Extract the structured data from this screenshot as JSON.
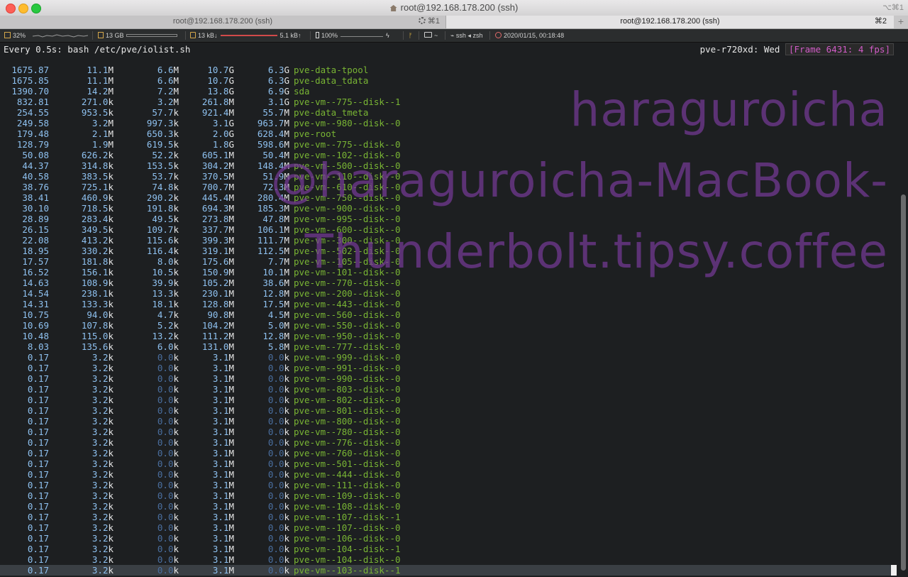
{
  "window": {
    "title": "root@192.168.178.200 (ssh)",
    "shortcut": "⌥⌘1"
  },
  "tabs": [
    {
      "label": "root@192.168.178.200 (ssh)",
      "shortcut": "⌘1",
      "active": false
    },
    {
      "label": "root@192.168.178.200 (ssh)",
      "shortcut": "⌘2",
      "active": true
    }
  ],
  "status_bar": {
    "cpu": "32%",
    "mem": "13 GB",
    "net_down": "13 kB↓",
    "net_up": "5.1 kB↑",
    "battery": "100%",
    "path": "~",
    "shell": "ssh ◂ zsh",
    "datetime": "2020/01/15, 00:18:48"
  },
  "terminal": {
    "command": "Every 0.5s: bash /etc/pve/iolist.sh",
    "host_prefix": "pve-r720xd: Wed ",
    "frame": "[Frame 6431: 4 fps]",
    "rows": [
      [
        "1675.87",
        "11.1M",
        "6.6M",
        "10.7G",
        "6.3G",
        "pve-data-tpool"
      ],
      [
        "1675.85",
        "11.1M",
        "6.6M",
        "10.7G",
        "6.3G",
        "pve-data_tdata"
      ],
      [
        "1390.70",
        "14.2M",
        "7.2M",
        "13.8G",
        "6.9G",
        "sda"
      ],
      [
        "832.81",
        "271.0k",
        "3.2M",
        "261.8M",
        "3.1G",
        "pve-vm--775--disk--1"
      ],
      [
        "254.55",
        "953.5k",
        "57.7k",
        "921.4M",
        "55.7M",
        "pve-data_tmeta"
      ],
      [
        "249.58",
        "3.2M",
        "997.3k",
        "3.1G",
        "963.7M",
        "pve-vm--980--disk--0"
      ],
      [
        "179.48",
        "2.1M",
        "650.3k",
        "2.0G",
        "628.4M",
        "pve-root"
      ],
      [
        "128.79",
        "1.9M",
        "619.5k",
        "1.8G",
        "598.6M",
        "pve-vm--775--disk--0"
      ],
      [
        "50.08",
        "626.2k",
        "52.2k",
        "605.1M",
        "50.4M",
        "pve-vm--102--disk--0"
      ],
      [
        "44.37",
        "314.8k",
        "153.5k",
        "304.2M",
        "148.4M",
        "pve-vm--500--disk--0"
      ],
      [
        "40.58",
        "383.5k",
        "53.7k",
        "370.5M",
        "51.9M",
        "pve-vm--110--disk--0"
      ],
      [
        "38.76",
        "725.1k",
        "74.8k",
        "700.7M",
        "72.3M",
        "pve-vm--610--disk--0"
      ],
      [
        "38.41",
        "460.9k",
        "290.2k",
        "445.4M",
        "280.4M",
        "pve-vm--750--disk--0"
      ],
      [
        "30.10",
        "718.5k",
        "191.8k",
        "694.3M",
        "185.3M",
        "pve-vm--900--disk--0"
      ],
      [
        "28.89",
        "283.4k",
        "49.5k",
        "273.8M",
        "47.8M",
        "pve-vm--995--disk--0"
      ],
      [
        "26.15",
        "349.5k",
        "109.7k",
        "337.7M",
        "106.1M",
        "pve-vm--600--disk--0"
      ],
      [
        "22.08",
        "413.2k",
        "115.6k",
        "399.3M",
        "111.7M",
        "pve-vm--300--disk--0"
      ],
      [
        "18.95",
        "330.2k",
        "116.4k",
        "319.1M",
        "112.5M",
        "pve-vm--502--disk--0"
      ],
      [
        "17.57",
        "181.8k",
        "8.0k",
        "175.6M",
        "7.7M",
        "pve-vm--105--disk--0"
      ],
      [
        "16.52",
        "156.1k",
        "10.5k",
        "150.9M",
        "10.1M",
        "pve-vm--101--disk--0"
      ],
      [
        "14.63",
        "108.9k",
        "39.9k",
        "105.2M",
        "38.6M",
        "pve-vm--770--disk--0"
      ],
      [
        "14.54",
        "238.1k",
        "13.3k",
        "230.1M",
        "12.8M",
        "pve-vm--200--disk--0"
      ],
      [
        "14.31",
        "133.3k",
        "18.1k",
        "128.8M",
        "17.5M",
        "pve-vm--443--disk--0"
      ],
      [
        "10.75",
        "94.0k",
        "4.7k",
        "90.8M",
        "4.5M",
        "pve-vm--560--disk--0"
      ],
      [
        "10.69",
        "107.8k",
        "5.2k",
        "104.2M",
        "5.0M",
        "pve-vm--550--disk--0"
      ],
      [
        "10.48",
        "115.0k",
        "13.2k",
        "111.2M",
        "12.8M",
        "pve-vm--950--disk--0"
      ],
      [
        "8.03",
        "135.6k",
        "6.0k",
        "131.0M",
        "5.8M",
        "pve-vm--777--disk--0"
      ],
      [
        "0.17",
        "3.2k",
        "0.0k",
        "3.1M",
        "0.0k",
        "pve-vm--999--disk--0"
      ],
      [
        "0.17",
        "3.2k",
        "0.0k",
        "3.1M",
        "0.0k",
        "pve-vm--991--disk--0"
      ],
      [
        "0.17",
        "3.2k",
        "0.0k",
        "3.1M",
        "0.0k",
        "pve-vm--990--disk--0"
      ],
      [
        "0.17",
        "3.2k",
        "0.0k",
        "3.1M",
        "0.0k",
        "pve-vm--803--disk--0"
      ],
      [
        "0.17",
        "3.2k",
        "0.0k",
        "3.1M",
        "0.0k",
        "pve-vm--802--disk--0"
      ],
      [
        "0.17",
        "3.2k",
        "0.0k",
        "3.1M",
        "0.0k",
        "pve-vm--801--disk--0"
      ],
      [
        "0.17",
        "3.2k",
        "0.0k",
        "3.1M",
        "0.0k",
        "pve-vm--800--disk--0"
      ],
      [
        "0.17",
        "3.2k",
        "0.0k",
        "3.1M",
        "0.0k",
        "pve-vm--780--disk--0"
      ],
      [
        "0.17",
        "3.2k",
        "0.0k",
        "3.1M",
        "0.0k",
        "pve-vm--776--disk--0"
      ],
      [
        "0.17",
        "3.2k",
        "0.0k",
        "3.1M",
        "0.0k",
        "pve-vm--760--disk--0"
      ],
      [
        "0.17",
        "3.2k",
        "0.0k",
        "3.1M",
        "0.0k",
        "pve-vm--501--disk--0"
      ],
      [
        "0.17",
        "3.2k",
        "0.0k",
        "3.1M",
        "0.0k",
        "pve-vm--444--disk--0"
      ],
      [
        "0.17",
        "3.2k",
        "0.0k",
        "3.1M",
        "0.0k",
        "pve-vm--111--disk--0"
      ],
      [
        "0.17",
        "3.2k",
        "0.0k",
        "3.1M",
        "0.0k",
        "pve-vm--109--disk--0"
      ],
      [
        "0.17",
        "3.2k",
        "0.0k",
        "3.1M",
        "0.0k",
        "pve-vm--108--disk--0"
      ],
      [
        "0.17",
        "3.2k",
        "0.0k",
        "3.1M",
        "0.0k",
        "pve-vm--107--disk--1"
      ],
      [
        "0.17",
        "3.2k",
        "0.0k",
        "3.1M",
        "0.0k",
        "pve-vm--107--disk--0"
      ],
      [
        "0.17",
        "3.2k",
        "0.0k",
        "3.1M",
        "0.0k",
        "pve-vm--106--disk--0"
      ],
      [
        "0.17",
        "3.2k",
        "0.0k",
        "3.1M",
        "0.0k",
        "pve-vm--104--disk--1"
      ],
      [
        "0.17",
        "3.2k",
        "0.0k",
        "3.1M",
        "0.0k",
        "pve-vm--104--disk--0"
      ],
      [
        "0.17",
        "3.2k",
        "0.0k",
        "3.1M",
        "0.0k",
        "pve-vm--103--disk--1"
      ]
    ]
  },
  "watermark": [
    "haraguroicha",
    "@haraguroicha-MacBook-",
    "Thunderbolt.tipsy.coffee"
  ],
  "colors": {
    "numbers": "#8ec1f0",
    "names": "#79b534",
    "frame": "#d15cc8",
    "watermark": "#743a96"
  }
}
